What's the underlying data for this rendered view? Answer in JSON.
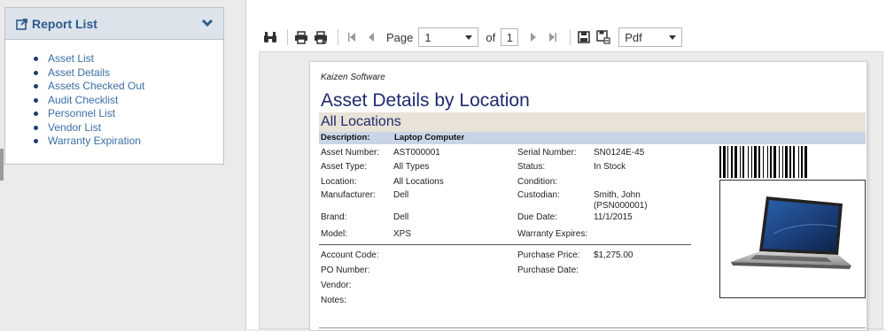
{
  "sidebar": {
    "title": "Report List",
    "items": [
      {
        "label": "Asset List"
      },
      {
        "label": "Asset Details"
      },
      {
        "label": "Assets Checked Out"
      },
      {
        "label": "Audit Checklist"
      },
      {
        "label": "Personnel List"
      },
      {
        "label": "Vendor List"
      },
      {
        "label": "Warranty Expiration"
      }
    ]
  },
  "toolbar": {
    "page_label": "Page",
    "page_value": "1",
    "of_label": "of",
    "total_pages": "1",
    "format_value": "Pdf"
  },
  "report": {
    "company": "Kaizen Software",
    "title": "Asset Details by Location",
    "location_band": "All Locations",
    "description_label": "Description:",
    "description_value": "Laptop Computer",
    "asset_number_label": "Asset Number:",
    "asset_number_value": "AST000001",
    "asset_type_label": "Asset Type:",
    "asset_type_value": "All Types",
    "location_label": "Location:",
    "location_value": "All Locations",
    "manufacturer_label": "Manufacturer:",
    "manufacturer_value": "Dell",
    "brand_label": "Brand:",
    "brand_value": "Dell",
    "model_label": "Model:",
    "model_value": "XPS",
    "serial_label": "Serial Number:",
    "serial_value": "SN0124E-45",
    "status_label": "Status:",
    "status_value": "In Stock",
    "condition_label": "Condition:",
    "custodian_label": "Custodian:",
    "custodian_value_line1": "Smith, John",
    "custodian_value_line2": "(PSN000001)",
    "due_date_label": "Due Date:",
    "due_date_value": "11/1/2015",
    "warranty_label": "Warranty Expires:",
    "account_code_label": "Account Code:",
    "po_number_label": "PO Number:",
    "vendor_label": "Vendor:",
    "notes_label": "Notes:",
    "purchase_price_label": "Purchase Price:",
    "purchase_price_value": "$1,275.00",
    "purchase_date_label": "Purchase Date:"
  },
  "colors": {
    "accent": "#2f5b8e",
    "report_title": "#1f2a6d",
    "location_band": "#e9e2d7",
    "description_band": "#c8d5e6"
  }
}
